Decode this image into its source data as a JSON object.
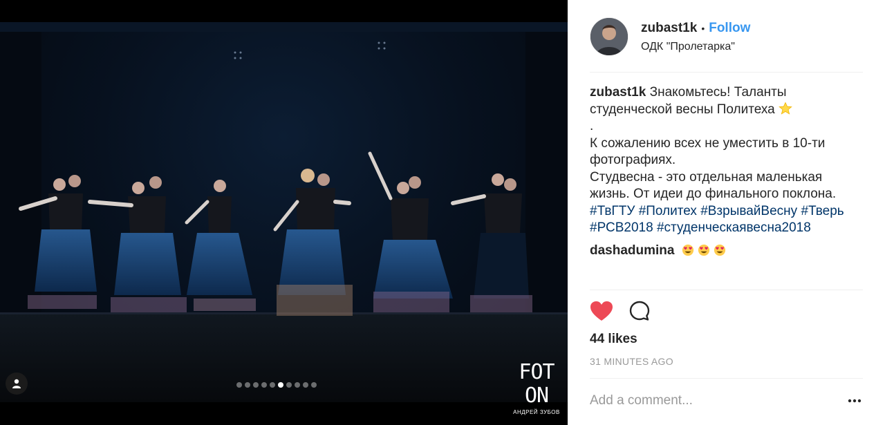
{
  "post": {
    "username": "zubast1k",
    "separator": "•",
    "follow_label": "Follow",
    "location": "ОДК \"Пролетарка\""
  },
  "caption": {
    "username": "zubast1k",
    "line1": "Знакомьтесь! Таланты",
    "line2": "студенческой весны Политеха",
    "line2_emoji": "star-emoji",
    "line3": ".",
    "line4": "К сожалению всех не уместить в 10-ти",
    "line5": "фотографиях.",
    "line6": "Студвесна - это отдельная маленькая",
    "line7": "жизнь. От идеи до финального поклона.",
    "hashtags_line1": [
      "#ТвГТУ",
      "#Политех",
      "#ВзрывайВесну",
      "#Тверь"
    ],
    "hashtags_line2": [
      "#РСВ2018",
      "#студенческаявесна2018"
    ]
  },
  "comment": {
    "username": "dashadumina",
    "emojis": [
      "heart-eyes-emoji",
      "heart-eyes-emoji",
      "heart-eyes-emoji"
    ]
  },
  "actions": {
    "like_icon": "heart-icon",
    "like_color": "#ed4956",
    "comment_icon": "comment-bubble-icon"
  },
  "likes_text": "44 likes",
  "timestamp": "31 MINUTES AGO",
  "add_comment": {
    "placeholder": "Add a comment..."
  },
  "more_icon": "ellipsis-icon",
  "carousel": {
    "total": 10,
    "active_index": 5
  },
  "watermark": {
    "main": "FOT ON",
    "sub": "АНДРЕЙ ЗУБОВ"
  },
  "colors": {
    "link_blue": "#3897f0",
    "hashtag": "#003569",
    "muted": "#999999",
    "divider": "#efefef"
  }
}
